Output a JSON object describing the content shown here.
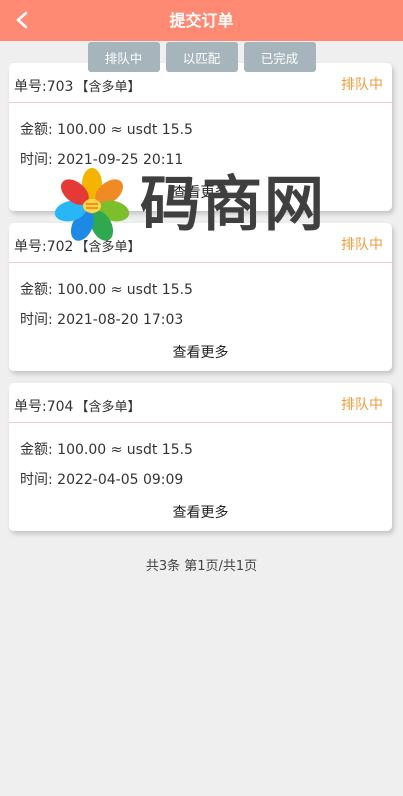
{
  "header": {
    "title": "提交订单",
    "back_icon": "chevron-left-icon",
    "color": "#ff8a73"
  },
  "tabs": [
    {
      "label": "排队中"
    },
    {
      "label": "以匹配"
    },
    {
      "label": "已完成"
    }
  ],
  "orders": [
    {
      "no_label": "单号:703",
      "tag": "【含多单】",
      "status": "排队中",
      "amount_label": "金额:",
      "amount_value": "100.00 ≈ usdt 15.5",
      "time_label": "时间:",
      "time_value": "2021-09-25 20:11",
      "more": "查看更多"
    },
    {
      "no_label": "单号:702",
      "tag": "【含多单】",
      "status": "排队中",
      "amount_label": "金额:",
      "amount_value": "100.00 ≈ usdt 15.5",
      "time_label": "时间:",
      "time_value": "2021-08-20 17:03",
      "more": "查看更多"
    },
    {
      "no_label": "单号:704",
      "tag": "【含多单】",
      "status": "排队中",
      "amount_label": "金额:",
      "amount_value": "100.00 ≈ usdt 15.5",
      "time_label": "时间:",
      "time_value": "2022-04-05 09:09",
      "more": "查看更多"
    }
  ],
  "pager": {
    "text": "共3条 第1页/共1页"
  },
  "watermark": {
    "text": "码商网"
  },
  "colors": {
    "status": "#f29b3a",
    "tab_bg": "#a6b5bc",
    "divider": "#f1c9c9"
  }
}
